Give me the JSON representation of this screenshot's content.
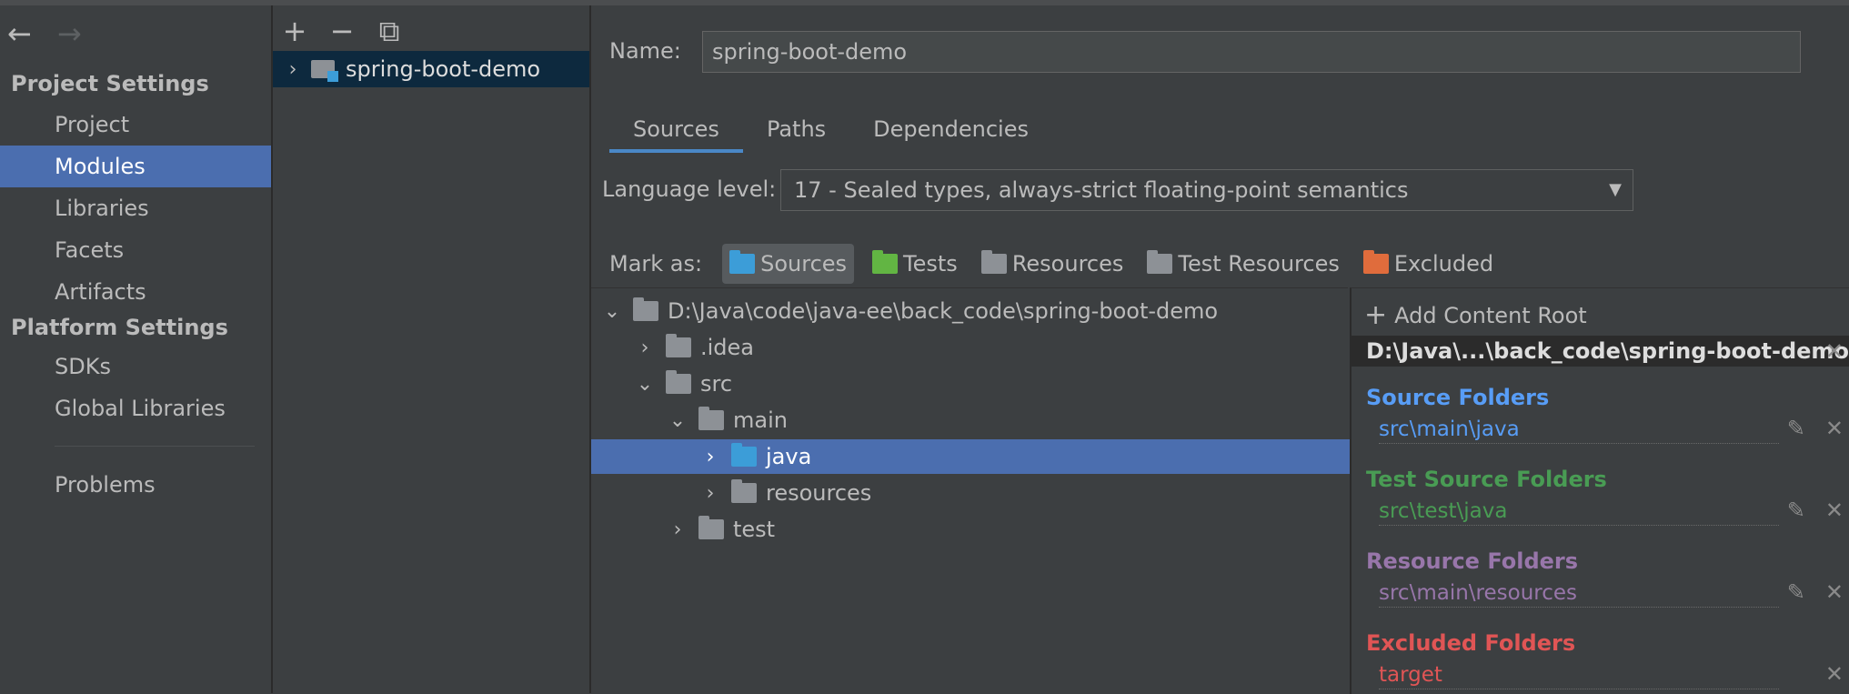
{
  "nav": {
    "back": "←",
    "forward": "→",
    "project_settings": "Project Settings",
    "platform_settings": "Platform Settings",
    "items": [
      {
        "label": "Project",
        "selected": false
      },
      {
        "label": "Modules",
        "selected": true
      },
      {
        "label": "Libraries",
        "selected": false
      },
      {
        "label": "Facets",
        "selected": false
      },
      {
        "label": "Artifacts",
        "selected": false
      }
    ],
    "platform_items": [
      {
        "label": "SDKs"
      },
      {
        "label": "Global Libraries"
      }
    ],
    "problems": "Problems"
  },
  "module_list": {
    "add": "+",
    "remove": "−",
    "copy": "⧉",
    "module": "spring-boot-demo"
  },
  "main": {
    "name_label": "Name:",
    "name_value": "spring-boot-demo",
    "tabs": [
      "Sources",
      "Paths",
      "Dependencies"
    ],
    "language_label": "Language level:",
    "language_value": "17 - Sealed types, always-strict floating-point semantics",
    "mark_as": "Mark as:",
    "mark_buttons": [
      {
        "label": "Sources",
        "color": "#3c9dd8"
      },
      {
        "label": "Tests",
        "color": "#62b543"
      },
      {
        "label": "Resources",
        "color": "#8d9196"
      },
      {
        "label": "Test Resources",
        "color": "#8d9196"
      },
      {
        "label": "Excluded",
        "color": "#e06c3c"
      }
    ]
  },
  "tree": {
    "root": "D:\\Java\\code\\java-ee\\back_code\\spring-boot-demo",
    "idea": ".idea",
    "src": "src",
    "main": "main",
    "java": "java",
    "resources": "resources",
    "test": "test"
  },
  "roots": {
    "add_label": "Add Content Root",
    "path": "D:\\Java\\...\\back_code\\spring-boot-demo",
    "source_title": "Source Folders",
    "source_item": "src\\main\\java",
    "test_title": "Test Source Folders",
    "test_item": "src\\test\\java",
    "resource_title": "Resource Folders",
    "resource_item": "src\\main\\resources",
    "excluded_title": "Excluded Folders",
    "excluded_item": "target",
    "colors": {
      "source": "#589df6",
      "test": "#499c54",
      "resource": "#9876aa",
      "excluded": "#e05555"
    }
  }
}
